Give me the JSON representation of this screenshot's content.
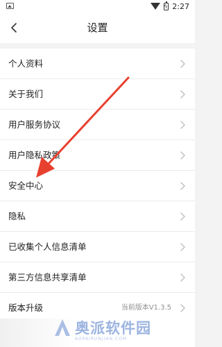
{
  "status_bar": {
    "time": "2:27",
    "icons": [
      "image-icon",
      "wifi-icon",
      "battery-charging-icon"
    ]
  },
  "header": {
    "title": "设置",
    "back_icon": "chevron-left-icon"
  },
  "settings": {
    "items": [
      {
        "label": "个人资料",
        "value": ""
      },
      {
        "label": "关于我们",
        "value": ""
      },
      {
        "label": "用户服务协议",
        "value": ""
      },
      {
        "label": "用户隐私政策",
        "value": ""
      },
      {
        "label": "安全中心",
        "value": ""
      },
      {
        "label": "隐私",
        "value": ""
      },
      {
        "label": "已收集个人信息清单",
        "value": ""
      },
      {
        "label": "第三方信息共享清单",
        "value": ""
      },
      {
        "label": "版本升级",
        "value": "当前版本V1.3.5"
      }
    ]
  },
  "annotation": {
    "arrow_color": "#e8402f",
    "points_to": "安全中心"
  },
  "watermark": {
    "text": "奥派软件园",
    "subtext": "AOPAIRUNJIAN.COM",
    "color": "#9cb4e0"
  }
}
